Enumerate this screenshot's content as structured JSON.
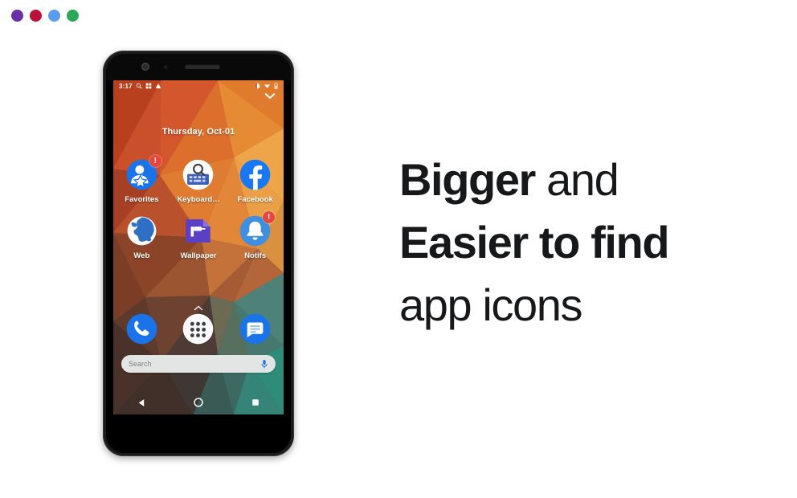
{
  "window": {
    "dots": [
      {
        "name": "dot-purple",
        "color": "#6b2fa8"
      },
      {
        "name": "dot-crimson",
        "color": "#bd1038"
      },
      {
        "name": "dot-blue",
        "color": "#5b9bf0"
      },
      {
        "name": "dot-green",
        "color": "#2aa858"
      }
    ]
  },
  "phone": {
    "status_bar": {
      "time": "3:17",
      "left_icons": [
        "search-icon",
        "apps-grid-icon",
        "triangle-icon"
      ],
      "right_icons": [
        "do-not-disturb-icon",
        "wifi-icon",
        "battery-icon"
      ],
      "expand_icon": "chevron-down-icon"
    },
    "date": "Thursday, Oct-01",
    "apps": [
      [
        {
          "label": "Favorites",
          "icon": "favorites-person-star-icon",
          "badge": "!",
          "badge_color": "#e8453c"
        },
        {
          "label": "Keyboard…",
          "icon": "keyboard-search-icon",
          "badge": "",
          "badge_color": ""
        },
        {
          "label": "Facebook",
          "icon": "facebook-icon",
          "badge": "",
          "badge_color": ""
        }
      ],
      [
        {
          "label": "Web",
          "icon": "globe-web-icon",
          "badge": "",
          "badge_color": ""
        },
        {
          "label": "Wallpaper",
          "icon": "wallpaper-roller-icon",
          "badge": "",
          "badge_color": ""
        },
        {
          "label": "Notifs",
          "icon": "notification-bell-icon",
          "badge": "!",
          "badge_color": "#e8453c"
        }
      ]
    ],
    "drawer_handle_icon": "chevron-up-icon",
    "dock": [
      {
        "name": "phone-dialer",
        "icon": "phone-handset-icon"
      },
      {
        "name": "app-drawer",
        "icon": "app-drawer-dots-icon"
      },
      {
        "name": "messages",
        "icon": "messages-bubble-icon"
      }
    ],
    "search": {
      "placeholder": "Search",
      "mic_icon": "microphone-icon"
    },
    "nav_bar": [
      {
        "name": "back",
        "icon": "back-triangle-icon"
      },
      {
        "name": "home",
        "icon": "home-circle-icon"
      },
      {
        "name": "recents",
        "icon": "recents-square-icon"
      }
    ]
  },
  "headline": {
    "line1_bold": "Bigger",
    "line1_rest": " and",
    "line2_bold": "Easier to find",
    "line3_regular": "app icons"
  },
  "colors": {
    "text": "#17181a",
    "accent_blue": "#1a73e8",
    "badge_red": "#e8453c",
    "search_bg": "#e3e5e4"
  }
}
